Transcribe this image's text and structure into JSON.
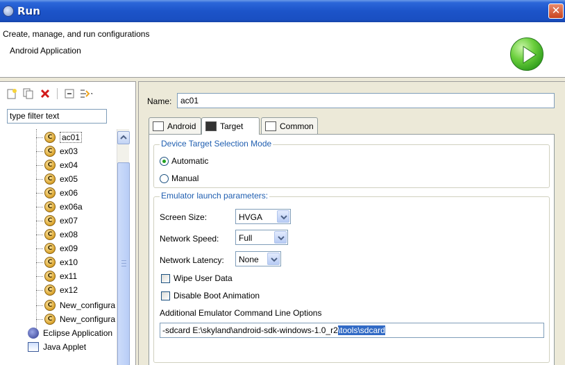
{
  "window": {
    "title": "Run",
    "close_glyph": "✕"
  },
  "header": {
    "description": "Create, manage, and run configurations",
    "subtitle": "Android Application",
    "icon": "run-icon"
  },
  "left_panel": {
    "toolbar_icons": [
      "new-config-icon",
      "duplicate-icon",
      "delete-icon",
      "collapse-all-icon",
      "filter-icon"
    ],
    "filter": {
      "value": "type filter text"
    },
    "tree_items": [
      {
        "label": "ac01",
        "icon": "c",
        "selected": true
      },
      {
        "label": "ex03",
        "icon": "c"
      },
      {
        "label": "ex04",
        "icon": "c"
      },
      {
        "label": "ex05",
        "icon": "c"
      },
      {
        "label": "ex06",
        "icon": "c"
      },
      {
        "label": "ex06a",
        "icon": "c"
      },
      {
        "label": "ex07",
        "icon": "c"
      },
      {
        "label": "ex08",
        "icon": "c"
      },
      {
        "label": "ex09",
        "icon": "c"
      },
      {
        "label": "ex10",
        "icon": "c"
      },
      {
        "label": "ex11",
        "icon": "c"
      },
      {
        "label": "ex12",
        "icon": "c"
      },
      {
        "label": "New_configura",
        "icon": "c"
      },
      {
        "label": "New_configura",
        "icon": "c"
      }
    ],
    "category_items": [
      {
        "label": "Eclipse Application",
        "icon": "eclipse-icon"
      },
      {
        "label": "Java Applet",
        "icon": "java-applet-icon"
      }
    ]
  },
  "right_panel": {
    "name_label": "Name:",
    "name_value": "ac01",
    "tabs": [
      {
        "label": "Android",
        "active": false
      },
      {
        "label": "Target",
        "active": true
      },
      {
        "label": "Common",
        "active": false
      }
    ],
    "target": {
      "mode_group_title": "Device Target Selection Mode",
      "mode_options": [
        {
          "label": "Automatic",
          "checked": true
        },
        {
          "label": "Manual",
          "checked": false
        }
      ],
      "emulator_group_title": "Emulator launch parameters:",
      "screen_size": {
        "label": "Screen Size:",
        "value": "HVGA"
      },
      "network_speed": {
        "label": "Network Speed:",
        "value": "Full"
      },
      "network_latency": {
        "label": "Network Latency:",
        "value": "None"
      },
      "wipe_user_data": {
        "label": "Wipe User Data",
        "checked": false
      },
      "disable_boot_animation": {
        "label": "Disable Boot Animation",
        "checked": false
      },
      "additional_options": {
        "label": "Additional Emulator Command Line Options",
        "value_plain": "-sdcard E:\\skyland\\android-sdk-windows-1.0_r2",
        "value_selected": "\\tools\\sdcard"
      }
    }
  }
}
